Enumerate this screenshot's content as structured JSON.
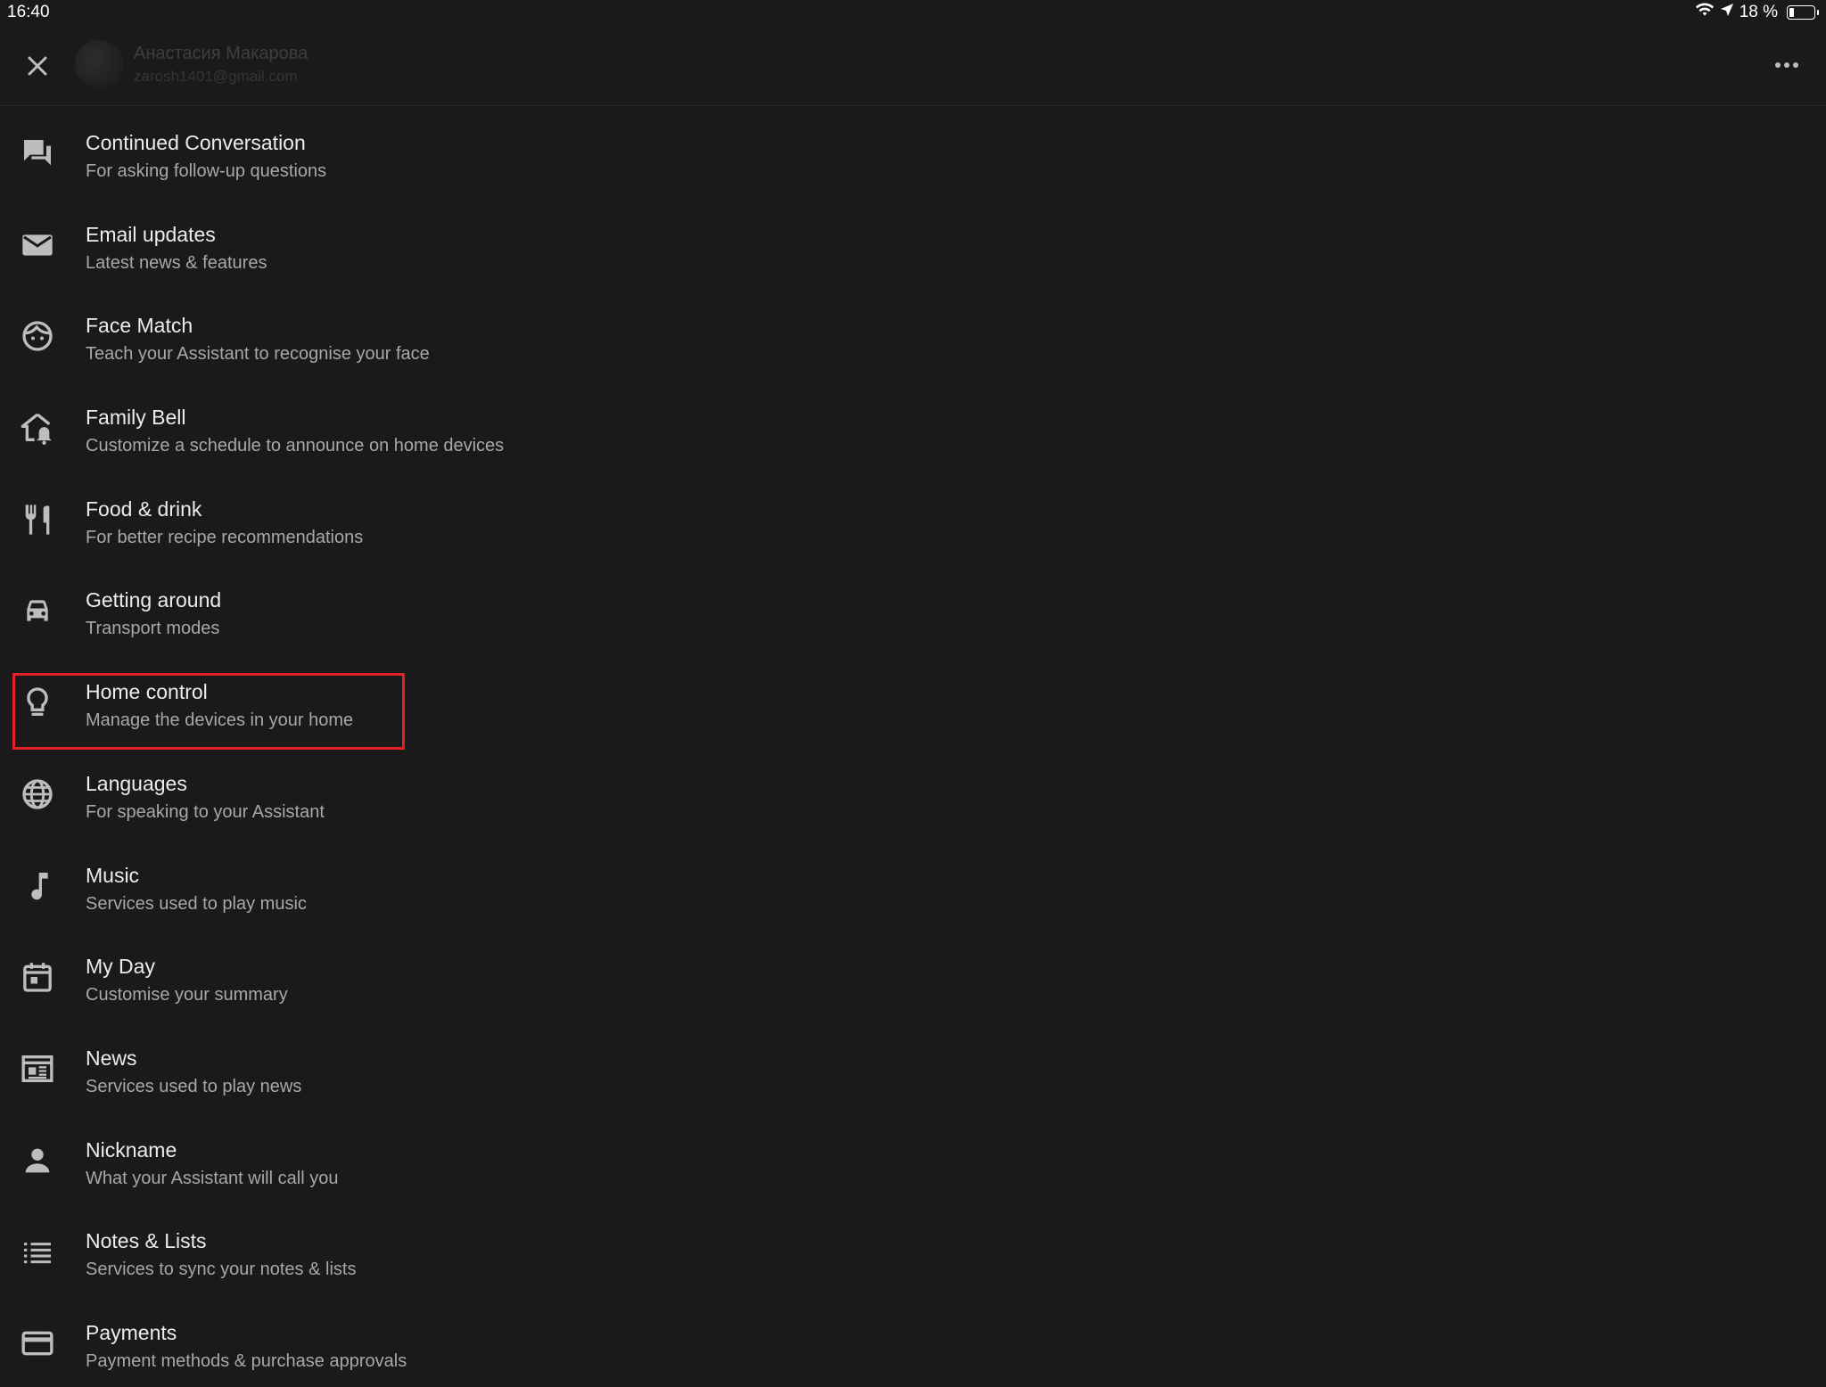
{
  "status_bar": {
    "time": "16:40",
    "battery": "18 %",
    "battery_level": 0.18,
    "icons": [
      "wifi-icon",
      "location-arrow-icon",
      "battery-icon"
    ]
  },
  "header": {
    "account_name": "Анастасия Макарова",
    "account_email": "zarosh1401@gmail.com",
    "close_icon": "close-icon",
    "more_icon": "more-horiz-icon"
  },
  "settings": [
    {
      "title": "Continued Conversation",
      "subtitle": "For asking follow-up questions",
      "icon": "chat-bubbles-icon"
    },
    {
      "title": "Email updates",
      "subtitle": "Latest news & features",
      "icon": "mail-icon"
    },
    {
      "title": "Face Match",
      "subtitle": "Teach your Assistant to recognise your face",
      "icon": "face-icon"
    },
    {
      "title": "Family Bell",
      "subtitle": "Customize a schedule to announce on home devices",
      "icon": "home-bell-icon"
    },
    {
      "title": "Food & drink",
      "subtitle": "For better recipe recommendations",
      "icon": "restaurant-icon"
    },
    {
      "title": "Getting around",
      "subtitle": "Transport modes",
      "icon": "car-icon"
    },
    {
      "title": "Home control",
      "subtitle": "Manage the devices in your home",
      "icon": "lightbulb-icon"
    },
    {
      "title": "Languages",
      "subtitle": "For speaking to your Assistant",
      "icon": "globe-icon"
    },
    {
      "title": "Music",
      "subtitle": "Services used to play music",
      "icon": "music-note-icon"
    },
    {
      "title": "My Day",
      "subtitle": "Customise your summary",
      "icon": "calendar-icon"
    },
    {
      "title": "News",
      "subtitle": "Services used to play news",
      "icon": "newspaper-icon"
    },
    {
      "title": "Nickname",
      "subtitle": "What your Assistant will call you",
      "icon": "person-icon"
    },
    {
      "title": "Notes & Lists",
      "subtitle": "Services to sync your notes & lists",
      "icon": "list-icon"
    },
    {
      "title": "Payments",
      "subtitle": "Payment methods & purchase approvals",
      "icon": "credit-card-icon"
    }
  ],
  "highlighted_item": "Home control",
  "colors": {
    "background": "#1a1a1a",
    "icon": "#bdbdbd",
    "highlight_border": "#e3202a"
  }
}
